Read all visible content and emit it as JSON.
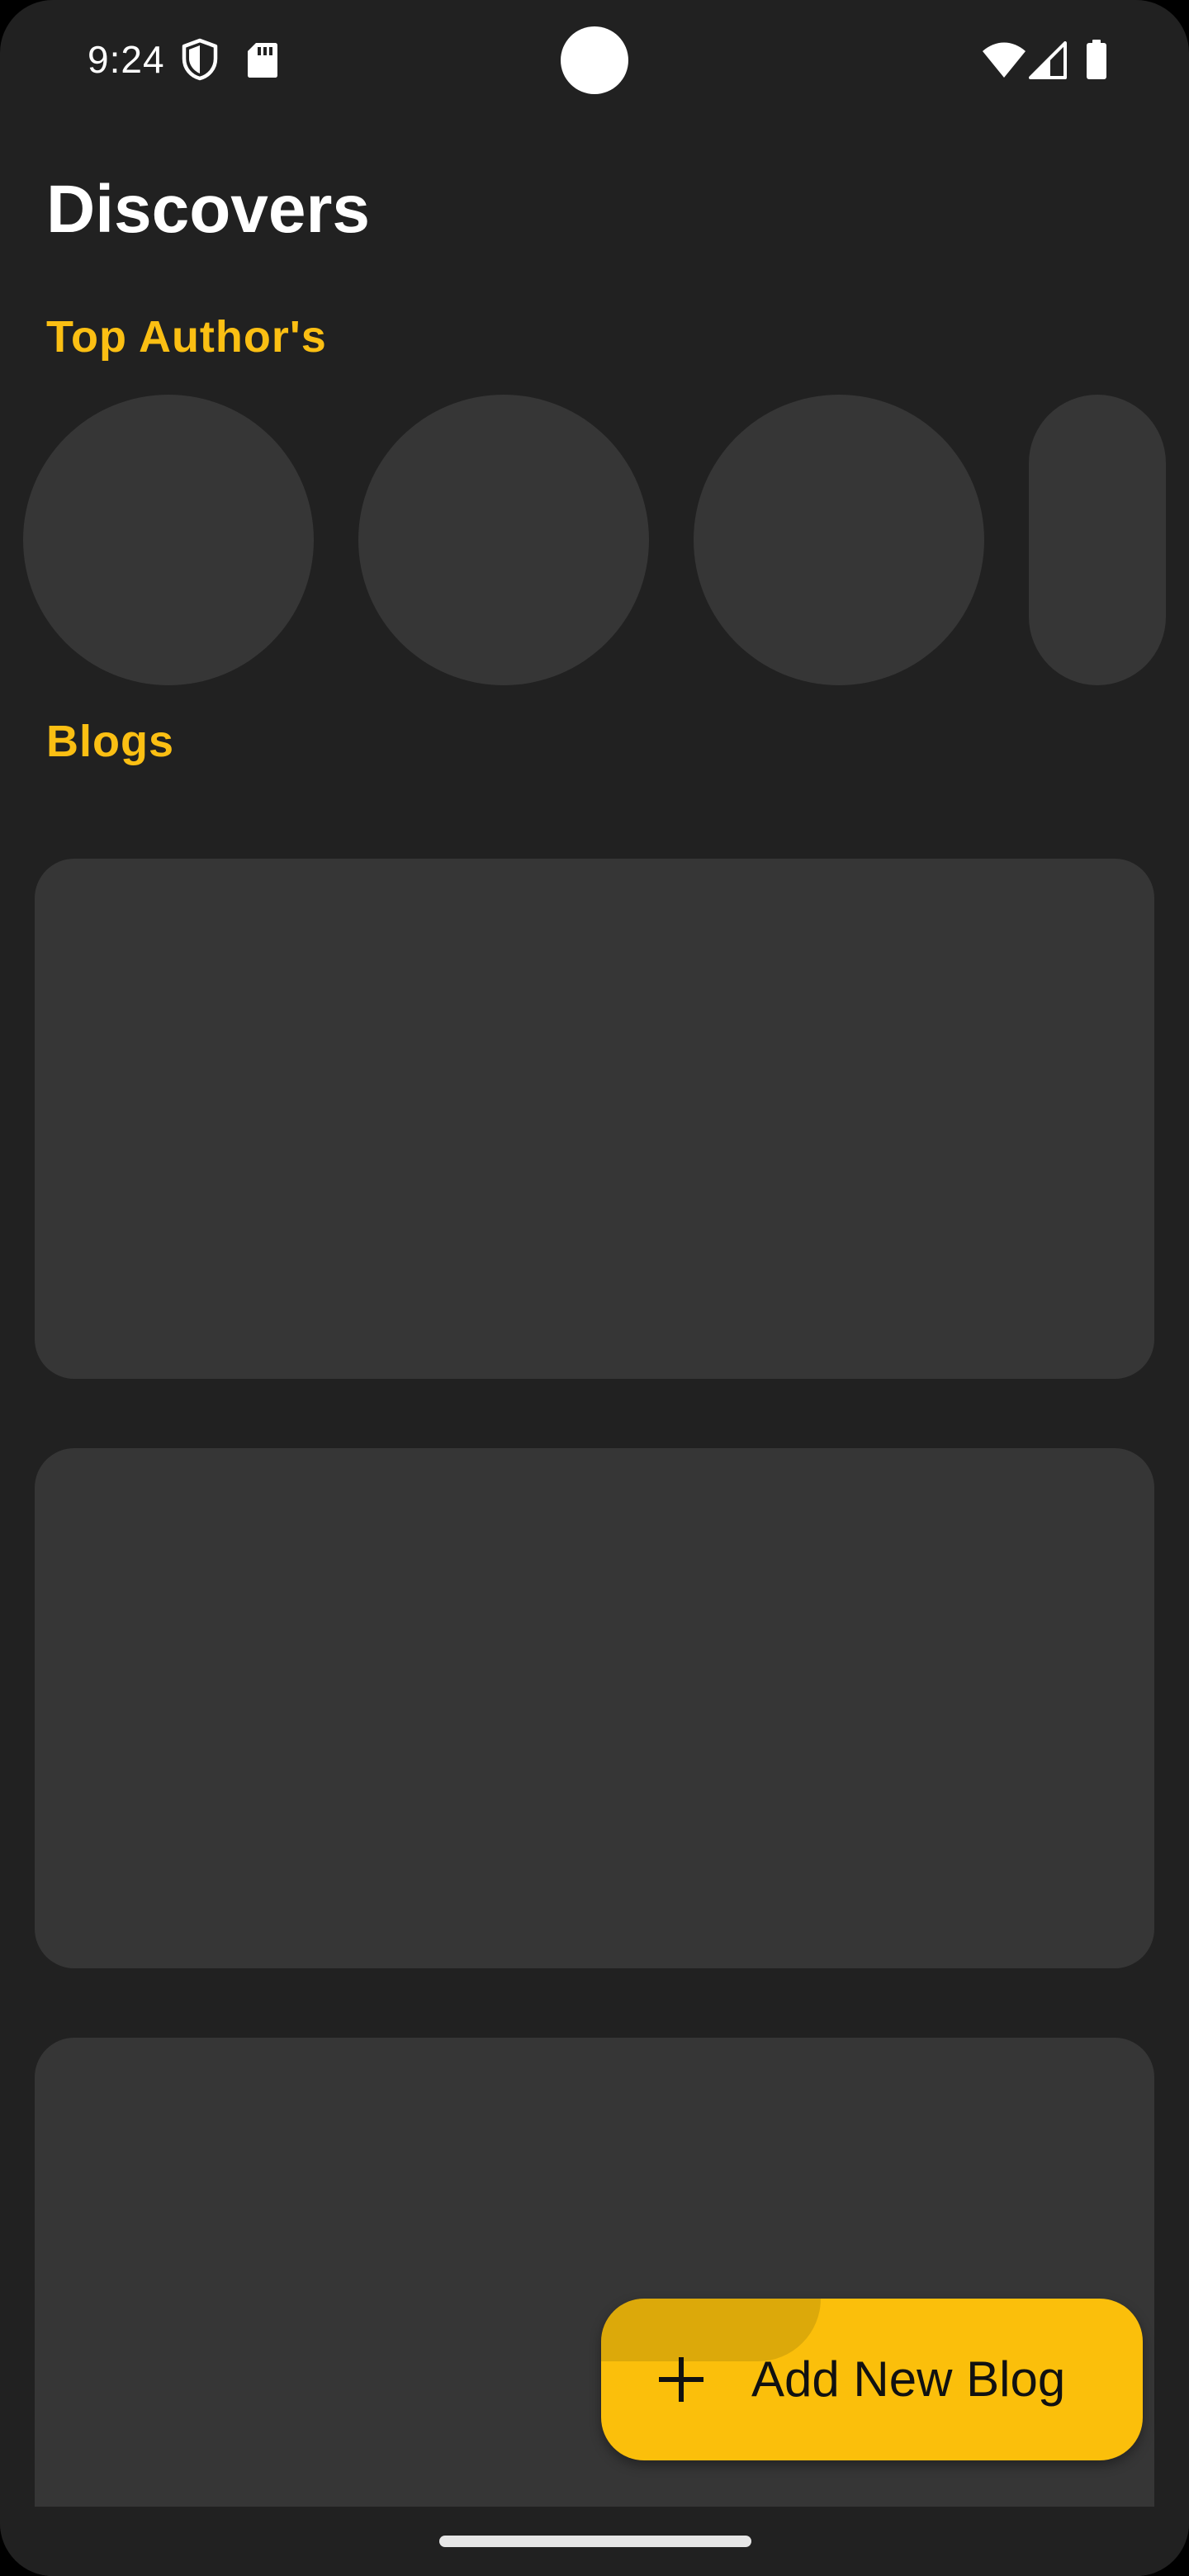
{
  "status_bar": {
    "time": "9:24",
    "icons": [
      "shield-icon",
      "sd-card-icon",
      "wifi-icon",
      "cellular-signal-icon",
      "battery-icon"
    ]
  },
  "page": {
    "title": "Discovers"
  },
  "sections": {
    "top_authors_label": "Top Author's",
    "blogs_label": "Blogs"
  },
  "fab": {
    "label": "Add New Blog",
    "icon": "plus-icon",
    "color": "#fbbf0b"
  },
  "colors": {
    "background": "#212121",
    "placeholder": "#363636",
    "accent": "#fbbf13",
    "title": "#ffffff"
  }
}
